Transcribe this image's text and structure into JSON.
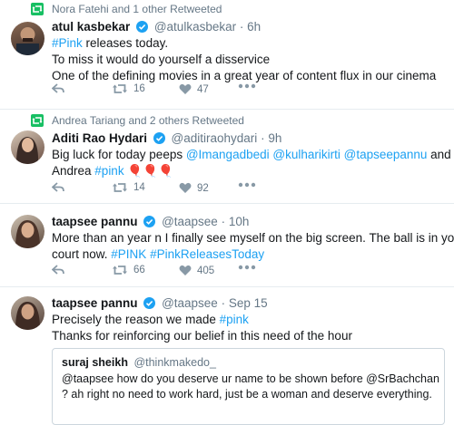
{
  "tweets": [
    {
      "retweet_line": "Nora Fatehi and 1 other Retweeted",
      "name": "atul kasbekar",
      "handle": "@atulkasbekar",
      "time": "· 6h",
      "lines": [
        {
          "hashtag": "#Pink",
          "rest": " releases today."
        },
        {
          "text": "To miss it would do yourself a disservice"
        },
        {
          "text": "One of the defining movies in a great year of content flux in our cinema"
        }
      ],
      "retweets": "16",
      "likes": "47"
    },
    {
      "retweet_line": "Andrea Tariang and 2 others Retweeted",
      "name": "Aditi Rao Hydari",
      "handle": "@aditiraohydari",
      "time": "· 9h",
      "line1_prefix": "Big luck for today peeps ",
      "mention1": "@Imangadbedi",
      "mention2": "@kulharikirti",
      "mention3": "@tapseepannu",
      "line1_suffix": " and",
      "line2_prefix": "Andrea ",
      "hashtag": "#pink",
      "emoji": "🎈🎈🎈",
      "retweets": "14",
      "likes": "92"
    },
    {
      "name": "taapsee pannu",
      "handle": "@taapsee",
      "time": "· 10h",
      "line1": "More than an year n I finally see myself on the big screen. The ball is in your",
      "line2_prefix": "court now. ",
      "hashtag1": "#PINK",
      "hashtag2": "#PinkReleasesToday",
      "retweets": "66",
      "likes": "405"
    },
    {
      "name": "taapsee pannu",
      "handle": "@taapsee",
      "time": "· Sep 15",
      "line1_prefix": "Precisely the reason we made ",
      "hashtag": "#pink",
      "line2": "Thanks for reinforcing our belief in this need of the hour",
      "quote": {
        "name": "suraj sheikh",
        "handle": "@thinkmakedo_",
        "line1": "@taapsee how do you deserve ur name to be shown before @SrBachchan",
        "line2": "? ah right no need to work hard, just be a woman and deserve everything."
      }
    }
  ]
}
